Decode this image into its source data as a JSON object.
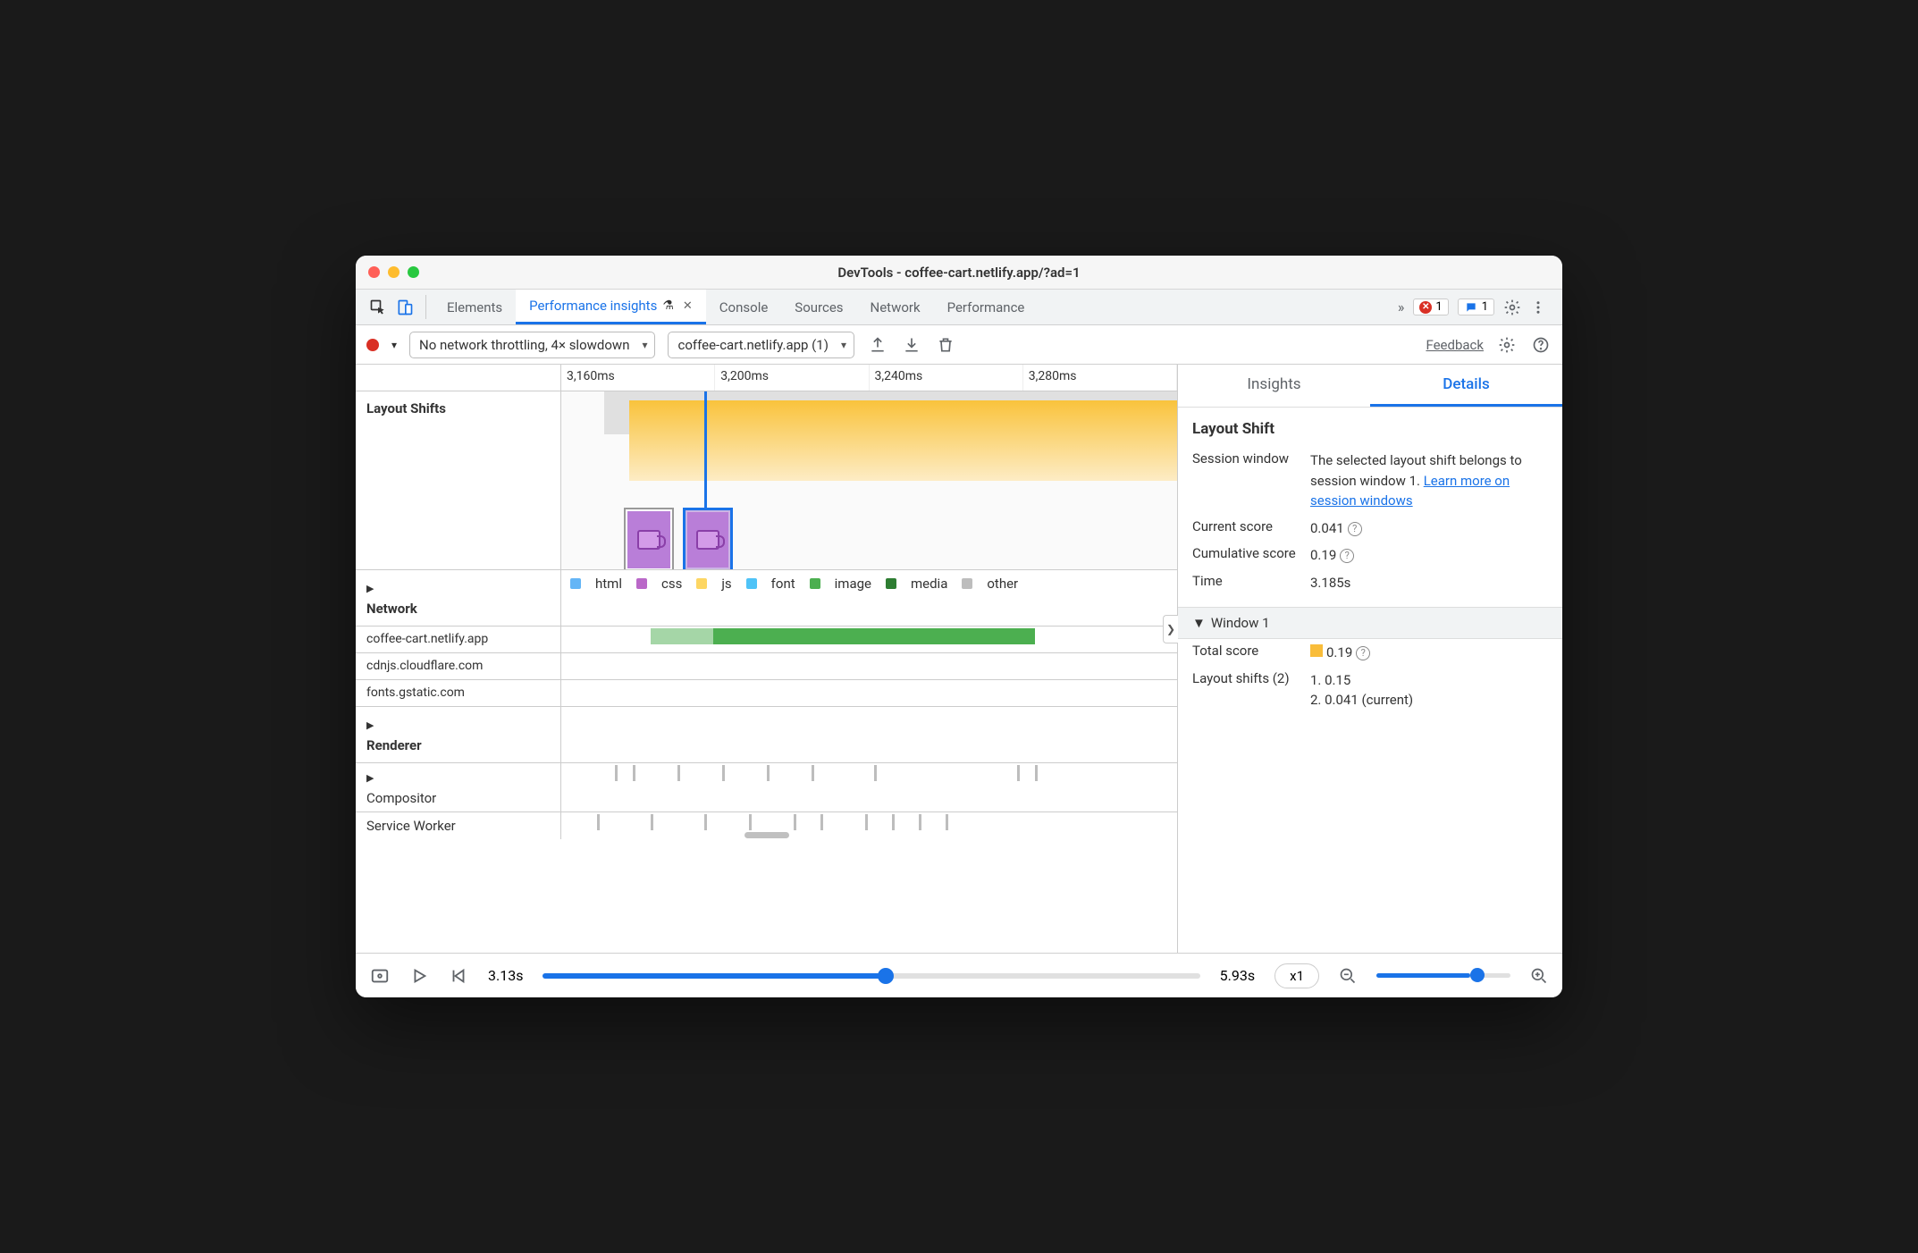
{
  "title": "DevTools - coffee-cart.netlify.app/?ad=1",
  "tabs": {
    "elements": "Elements",
    "perf_insights": "Performance insights",
    "console": "Console",
    "sources": "Sources",
    "network": "Network",
    "performance": "Performance"
  },
  "tabbar": {
    "errors": "1",
    "issues": "1",
    "more": "»"
  },
  "toolbar": {
    "throttle": "No network throttling, 4× slowdown",
    "recording": "coffee-cart.netlify.app (1)",
    "feedback": "Feedback"
  },
  "ruler": [
    "3,160ms",
    "3,200ms",
    "3,240ms",
    "3,280ms"
  ],
  "sections": {
    "layout_shifts": "Layout Shifts",
    "network": "Network",
    "renderer": "Renderer",
    "compositor": "Compositor",
    "service_worker": "Service Worker"
  },
  "legend": {
    "html": "html",
    "css": "css",
    "js": "js",
    "font": "font",
    "image": "image",
    "media": "media",
    "other": "other"
  },
  "net_hosts": [
    "coffee-cart.netlify.app",
    "cdnjs.cloudflare.com",
    "fonts.gstatic.com"
  ],
  "right": {
    "tabs": {
      "insights": "Insights",
      "details": "Details"
    },
    "title": "Layout Shift",
    "session_window_k": "Session window",
    "session_window_v": "The selected layout shift belongs to session window 1. ",
    "session_window_link": "Learn more on session windows",
    "current_score_k": "Current score",
    "current_score_v": "0.041",
    "cumulative_score_k": "Cumulative score",
    "cumulative_score_v": "0.19",
    "time_k": "Time",
    "time_v": "3.185s",
    "window_hdr": "Window 1",
    "total_score_k": "Total score",
    "total_score_v": "0.19",
    "ls_k": "Layout shifts (2)",
    "ls_1": "1. 0.15",
    "ls_2": "2. 0.041 (current)"
  },
  "footer": {
    "start": "3.13s",
    "end": "5.93s",
    "speed": "x1"
  }
}
